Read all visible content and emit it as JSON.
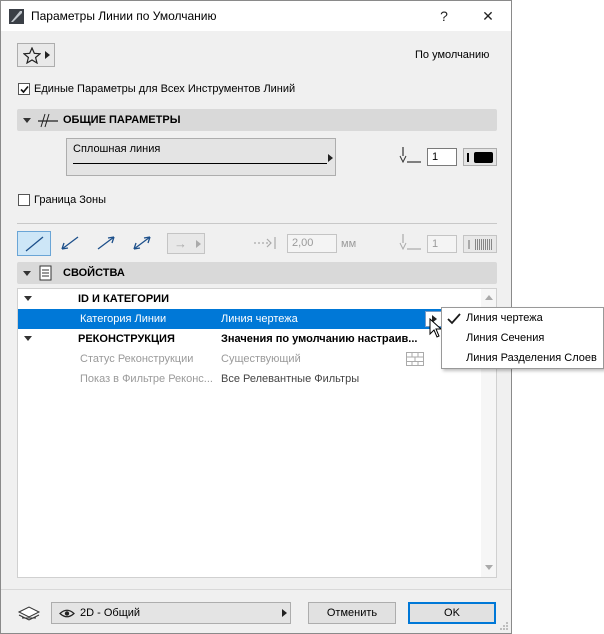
{
  "window": {
    "title": "Параметры Линии по Умолчанию",
    "help_glyph": "?",
    "close_glyph": "✕"
  },
  "top": {
    "favorites_icon": "star-icon",
    "default_label": "По умолчанию"
  },
  "unified_checkbox": {
    "label": "Единые Параметры для Всех Инструментов Линий",
    "checked": true
  },
  "general_section": {
    "title": "ОБЩИЕ ПАРАМЕТРЫ",
    "line_type_label": "Сплошная линия",
    "pen_number": "1"
  },
  "zone_boundary": {
    "label": "Граница Зоны",
    "checked": false
  },
  "geometry": {
    "arrow_glyph": "→",
    "offset_value": "2,00",
    "unit": "мм",
    "pen_number": "1"
  },
  "properties_section": {
    "title": "СВОЙСТВА",
    "groups": [
      {
        "title": "ID И КАТЕГОРИИ"
      },
      {
        "title": "РЕКОНСТРУКЦИЯ",
        "value": "Значения по умолчанию настраив..."
      }
    ],
    "rows": [
      {
        "name": "Категория Линии",
        "value": "Линия чертежа"
      },
      {
        "name": "Статус Реконструкции",
        "value": "Существующий"
      },
      {
        "name": "Показ в Фильтре Реконс...",
        "value": "Все Релевантные Фильтры"
      }
    ]
  },
  "dropdown": {
    "check_glyph": "✓",
    "options": [
      "Линия чертежа",
      "Линия Сечения",
      "Линия Разделения Слоев"
    ],
    "selected_index": 0
  },
  "footer": {
    "view_label": "2D - Общий",
    "cancel_label": "Отменить",
    "ok_label": "OK"
  },
  "colors": {
    "selection": "#0078d7",
    "section_bar": "#d9d9d9",
    "dialog_bg": "#f0f0f0"
  }
}
